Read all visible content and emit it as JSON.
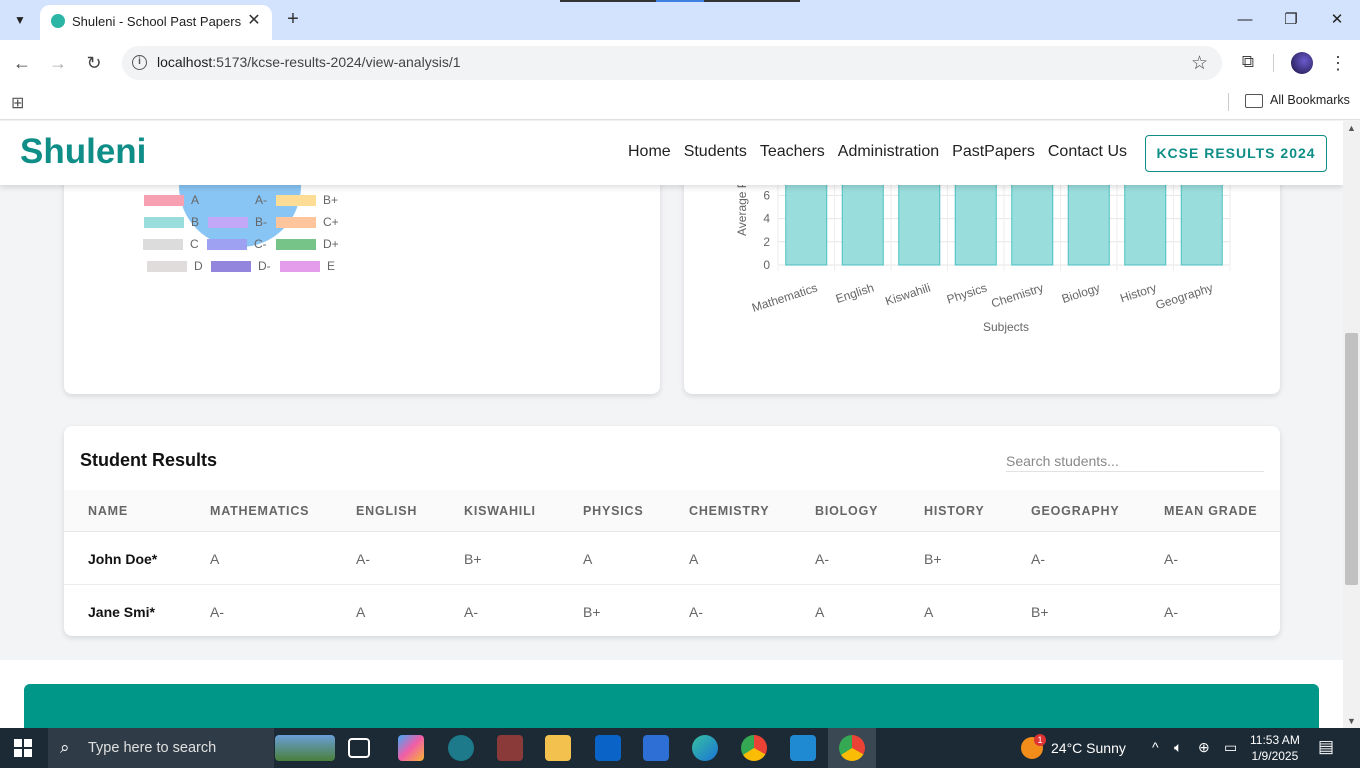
{
  "browser": {
    "tab_title": "Shuleni - School Past Papers & I",
    "url_host": "localhost",
    "url_path": ":5173/kcse-results-2024/view-analysis/1",
    "all_bookmarks": "All Bookmarks",
    "tab_close": "✕",
    "new_tab": "+",
    "minimize": "—",
    "maximize": "❐",
    "close": "✕"
  },
  "header": {
    "logo": "Shuleni",
    "nav": [
      "Home",
      "Students",
      "Teachers",
      "Administration",
      "PastPapers",
      "Contact Us"
    ],
    "kcse_button": "KCSE RESULTS 2024"
  },
  "pie_chart": {
    "visible_slice_color": "#88c4f4",
    "legend": [
      {
        "label": "A",
        "color": "#f7a0b2"
      },
      {
        "label": "A-",
        "color": "#88c4f4"
      },
      {
        "label": "B+",
        "color": "#fddc95"
      },
      {
        "label": "B",
        "color": "#99dddd"
      },
      {
        "label": "B-",
        "color": "#c3a8f7"
      },
      {
        "label": "C+",
        "color": "#fec49b"
      },
      {
        "label": "C",
        "color": "#dcdcdc"
      },
      {
        "label": "C-",
        "color": "#9ea0f2"
      },
      {
        "label": "D+",
        "color": "#77c488"
      },
      {
        "label": "D",
        "color": "#e0dcdc"
      },
      {
        "label": "D-",
        "color": "#9384dd"
      },
      {
        "label": "E",
        "color": "#e39deb"
      }
    ]
  },
  "chart_data": {
    "type": "bar",
    "categories": [
      "Mathematics",
      "English",
      "Kiswahili",
      "Physics",
      "Chemistry",
      "Biology",
      "History",
      "Geography"
    ],
    "values": [
      7,
      7,
      7,
      7,
      7,
      7,
      7,
      7
    ],
    "xlabel": "Subjects",
    "ylabel": "Average P",
    "y_ticks": [
      0,
      2,
      4,
      6
    ],
    "ylim": [
      0,
      8
    ],
    "bar_color": "#99dddd",
    "bar_border": "#4bc0c0",
    "grid": true
  },
  "results": {
    "title": "Student Results",
    "search_placeholder": "Search students...",
    "columns": [
      "NAME",
      "MATHEMATICS",
      "ENGLISH",
      "KISWAHILI",
      "PHYSICS",
      "CHEMISTRY",
      "BIOLOGY",
      "HISTORY",
      "GEOGRAPHY",
      "MEAN GRADE"
    ],
    "rows": [
      [
        "John Doe*",
        "A",
        "A-",
        "B+",
        "A",
        "A",
        "A-",
        "B+",
        "A-",
        "A-"
      ],
      [
        "Jane Smi*",
        "A-",
        "A",
        "A-",
        "B+",
        "A-",
        "A",
        "A",
        "B+",
        "A-"
      ]
    ]
  },
  "taskbar": {
    "search_text": "Type here to search",
    "weather_badge": "1",
    "weather": "24°C  Sunny",
    "time": "11:53 AM",
    "date": "1/9/2025"
  }
}
